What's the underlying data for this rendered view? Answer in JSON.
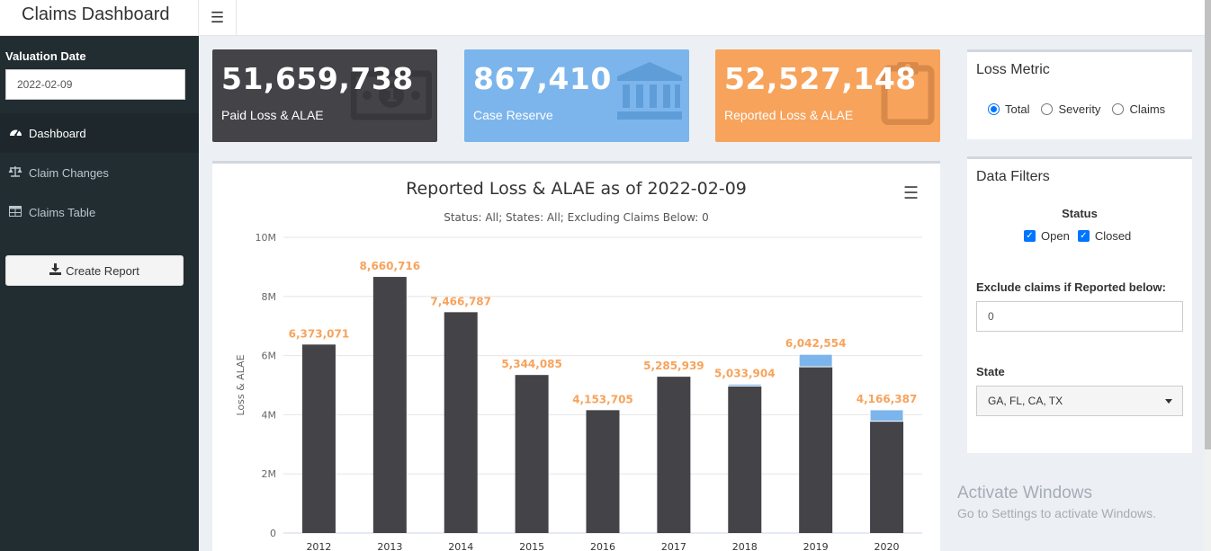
{
  "app": {
    "title": "Claims Dashboard",
    "menu_icon": "hamburger-icon"
  },
  "sidebar": {
    "valuation_label": "Valuation Date",
    "valuation_value": "2022-02-09",
    "items": [
      {
        "label": "Dashboard",
        "icon": "dashboard-icon",
        "active": true
      },
      {
        "label": "Claim Changes",
        "icon": "balance-scale-icon",
        "active": false
      },
      {
        "label": "Claims Table",
        "icon": "table-icon",
        "active": false
      }
    ],
    "report_button": "Create Report"
  },
  "value_boxes": [
    {
      "value": "51,659,738",
      "label": "Paid Loss & ALAE",
      "color": "#444348",
      "icon": "money-icon"
    },
    {
      "value": "867,410",
      "label": "Case Reserve",
      "color": "#7cb5ec",
      "icon": "bank-icon"
    },
    {
      "value": "52,527,148",
      "label": "Reported Loss & ALAE",
      "color": "#f7a35c",
      "icon": "clipboard-icon"
    }
  ],
  "chart": {
    "title": "Reported Loss & ALAE as of 2022-02-09",
    "subtitle": "Status: All; States: All; Excluding Claims Below: 0"
  },
  "chart_data": {
    "type": "bar",
    "stacked": true,
    "categories": [
      "2012",
      "2013",
      "2014",
      "2015",
      "2016",
      "2017",
      "2018",
      "2019",
      "2020"
    ],
    "series": [
      {
        "color": "#444348",
        "values": [
          6373071,
          8660716,
          7466787,
          5344085,
          4153705,
          5285939,
          4970000,
          5620000,
          3780000
        ]
      },
      {
        "color": "#7cb5ec",
        "values": [
          0,
          0,
          0,
          0,
          0,
          0,
          63904,
          422554,
          386387
        ]
      }
    ],
    "totals": [
      "6,373,071",
      "8,660,716",
      "7,466,787",
      "5,344,085",
      "4,153,705",
      "5,285,939",
      "5,033,904",
      "6,042,554",
      "4,166,387"
    ],
    "ylabel": "Loss & ALAE",
    "yticks": [
      "0",
      "2M",
      "4M",
      "6M",
      "8M",
      "10M"
    ],
    "ylim": [
      0,
      10000000
    ],
    "grid": true,
    "data_label_color": "#f7a35c"
  },
  "loss_metric": {
    "title": "Loss Metric",
    "options": [
      {
        "label": "Total",
        "selected": true
      },
      {
        "label": "Severity",
        "selected": false
      },
      {
        "label": "Claims",
        "selected": false
      }
    ]
  },
  "filters": {
    "title": "Data Filters",
    "status_label": "Status",
    "status_options": [
      {
        "label": "Open",
        "checked": true
      },
      {
        "label": "Closed",
        "checked": true
      }
    ],
    "exclude_label": "Exclude claims if Reported below:",
    "exclude_value": "0",
    "state_label": "State",
    "state_value": "GA, FL, CA, TX"
  },
  "watermark": {
    "title": "Activate Windows",
    "subtitle": "Go to Settings to activate Windows."
  }
}
